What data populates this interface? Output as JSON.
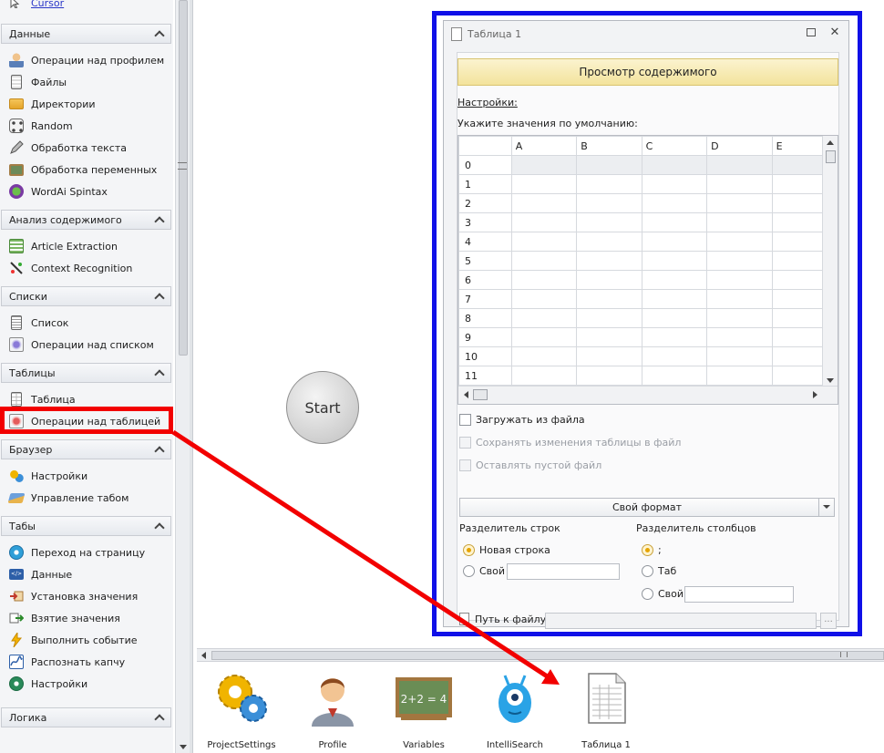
{
  "toolbox": {
    "top_item": "Cursor",
    "groups": [
      {
        "title": "Данные",
        "items": [
          "Операции над профилем",
          "Файлы",
          "Директории",
          "Random",
          "Обработка текста",
          "Обработка переменных",
          "WordAi Spintax"
        ]
      },
      {
        "title": "Анализ содержимого",
        "items": [
          "Article Extraction",
          "Context Recognition"
        ]
      },
      {
        "title": "Списки",
        "items": [
          "Список",
          "Операции над списком"
        ]
      },
      {
        "title": "Таблицы",
        "items": [
          "Таблица",
          "Операции над таблицей"
        ]
      },
      {
        "title": "Браузер",
        "items": [
          "Настройки",
          "Управление табом"
        ]
      },
      {
        "title": "Табы",
        "items": [
          "Переход на страницу",
          "Данные",
          "Установка значения",
          "Взятие значения",
          "Выполнить событие",
          "Распознать капчу",
          "Настройки"
        ]
      },
      {
        "title": "Логика",
        "items": []
      }
    ]
  },
  "canvas": {
    "start_label": "Start"
  },
  "dialog": {
    "title": "Таблица 1",
    "preview_button": "Просмотр содержимого",
    "settings_link": "Настройки:",
    "defaults_label": "Укажите значения по умолчанию:",
    "grid": {
      "columns": [
        "A",
        "B",
        "C",
        "D",
        "E"
      ],
      "rows": [
        "0",
        "1",
        "2",
        "3",
        "4",
        "5",
        "6",
        "7",
        "8",
        "9",
        "10",
        "11"
      ]
    },
    "load_from_file": "Загружать из файла",
    "save_changes": "Сохранять изменения таблицы в файл",
    "leave_empty": "Оставлять пустой файл",
    "format_value": "Свой формат",
    "row_sep_label": "Разделитель строк",
    "col_sep_label": "Разделитель столбцов",
    "row_sep_options": [
      "Новая строка",
      "Свой"
    ],
    "col_sep_options": [
      ";",
      "Таб",
      "Свой"
    ],
    "file_path_label": "Путь к файлу",
    "browse_label": "..."
  },
  "tray": {
    "items": [
      "ProjectSettings",
      "Profile",
      "Variables",
      "IntelliSearch",
      "Таблица 1"
    ]
  },
  "colors": {
    "highlight_red": "#f20000",
    "highlight_blue": "#1010e8",
    "accent_yellow": "#f3e39c"
  }
}
